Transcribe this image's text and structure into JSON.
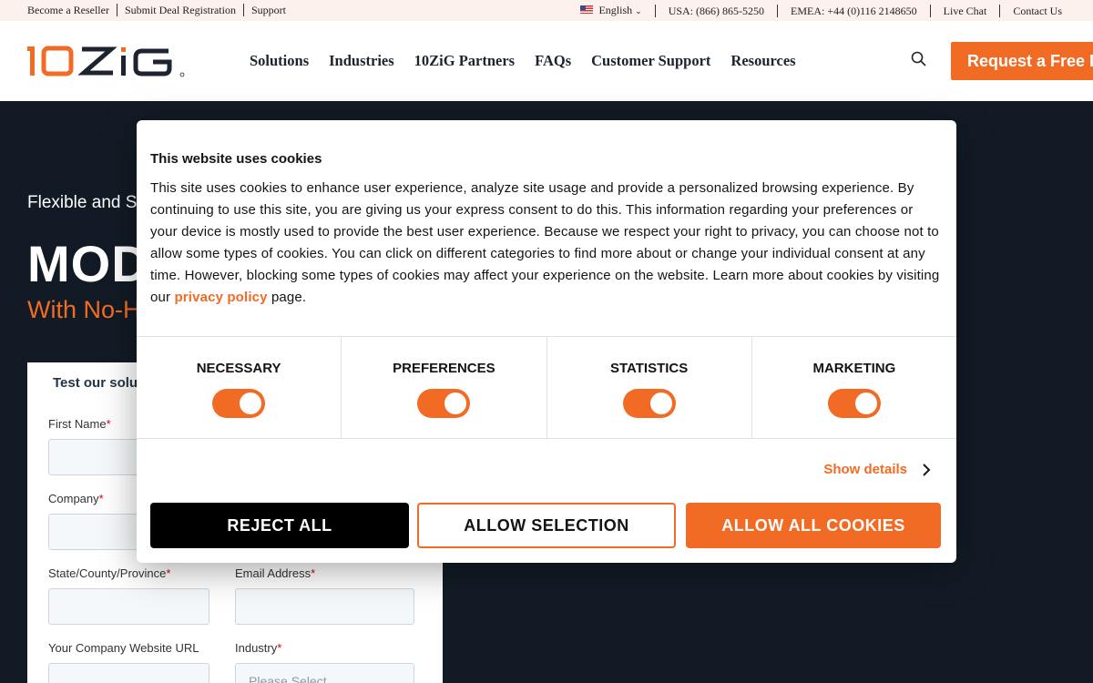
{
  "topbar": {
    "links": [
      "Become a Reseller",
      "Submit Deal Registration",
      "Support"
    ],
    "language": "English",
    "usa_phone": "USA: (866) 865-5250",
    "emea_phone": "EMEA: +44 (0)116 2148650",
    "live_chat": "Live Chat",
    "contact": "Contact Us"
  },
  "header": {
    "logo_text": "10ZiG",
    "nav": [
      "Solutions",
      "Industries",
      "10ZiG Partners",
      "FAQs",
      "Customer Support",
      "Resources"
    ],
    "cta": "Request a Free D"
  },
  "hero": {
    "subtitle": "Flexible and S",
    "title": "MOD",
    "tagline": "With No-H"
  },
  "form": {
    "title": "Test our solut",
    "first_name": "First Name",
    "company": "Company",
    "state": "State/County/Province",
    "email": "Email Address",
    "website": "Your Company Website URL",
    "industry": "Industry",
    "industry_placeholder": "Please Select",
    "required_mark": "*"
  },
  "cookie": {
    "title": "This website uses cookies",
    "body": "This site uses cookies to enhance user experience, analyze site usage and provide a personalized browsing experience. By continuing to use this site, you are giving us your express consent to do this. This information regarding your preferences or your device is mostly used to provide the best user experience. Because we respect your right to privacy, you can choose not to allow some types of cookies. You can click on different categories to find more about or change your individual consent at any time. However, blocking some types of cookies may affect your experience on the website. Learn more about cookies by visiting our",
    "link": "privacy policy",
    "body_end": " page.",
    "categories": [
      {
        "label": "NECESSARY",
        "on": true
      },
      {
        "label": "PREFERENCES",
        "on": true
      },
      {
        "label": "STATISTICS",
        "on": true
      },
      {
        "label": "MARKETING",
        "on": true
      }
    ],
    "show_details": "Show details",
    "reject": "REJECT ALL",
    "allow_selection": "ALLOW SELECTION",
    "allow_all": "ALLOW ALL COOKIES"
  },
  "colors": {
    "accent": "#f26b24",
    "hero_bg": "#121b25",
    "topbar_bg": "#fdf1ed"
  }
}
